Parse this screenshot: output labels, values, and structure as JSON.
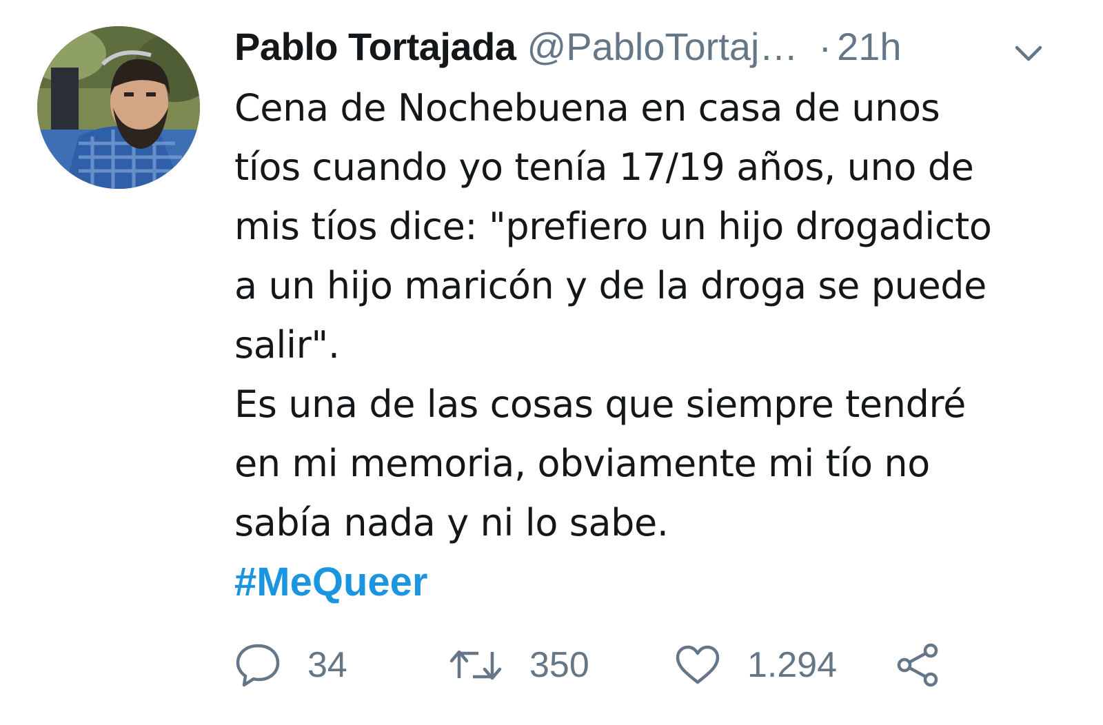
{
  "tweet": {
    "author": {
      "display_name": "Pablo Tortajada",
      "handle": "@PabloTortaj…"
    },
    "separator": "·",
    "time": "21h",
    "lines": [
      "Cena de Nochebuena en casa de unos",
      "tíos cuando yo tenía 17/19 años, uno de",
      "mis tíos dice: \"prefiero un hijo drogadicto",
      "a un hijo maricón y de la droga se puede",
      "salir\".",
      "Es una de las cosas que siempre tendré",
      "en mi memoria, obviamente mi tío no",
      "sabía nada y ni lo sabe."
    ],
    "hashtag": "#MeQueer",
    "actions": {
      "replies": "34",
      "retweets": "350",
      "likes": "1.294"
    },
    "icons": {
      "reply": "reply-icon",
      "retweet": "retweet-icon",
      "like": "heart-icon",
      "share": "share-icon",
      "menu": "chevron-down-icon"
    },
    "colors": {
      "text": "#14171a",
      "secondary": "#657786",
      "hashtag": "#1b95e0"
    }
  }
}
